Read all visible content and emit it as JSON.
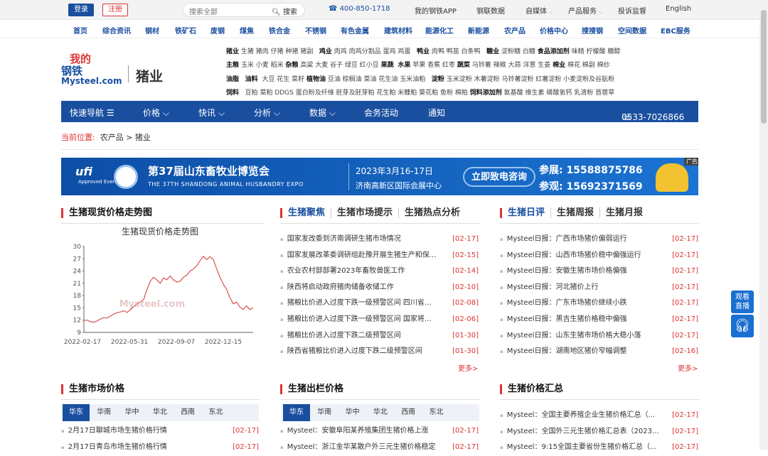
{
  "topbar": {
    "login": "登录",
    "register": "注册",
    "search_placeholder": "搜索全部",
    "search_btn": "搜索",
    "phone": "400-850-1718",
    "items": [
      "我的钢铁APP",
      "钢联数据",
      "自媒体",
      "产品服务",
      "投诉监督",
      "English"
    ]
  },
  "channels": [
    "首页",
    "综合资讯",
    "钢材",
    "铁矿石",
    "废钢",
    "煤焦",
    "铁合金",
    "不锈钢",
    "有色金属",
    "建筑材料",
    "能源化工",
    "新能源",
    "农产品",
    "价格中心",
    "搜搜钢",
    "空间数据",
    "EBC服务"
  ],
  "logo": {
    "top": "我的",
    "mid": "钢铁",
    "en": "Mysteel.com",
    "section": "猪业"
  },
  "keywords": [
    "<b>猪业</b> 生猪 猪肉 仔猪 种猪 猪副 &nbsp; <b>鸡业</b> 肉鸡 肉鸡分割品 蛋鸡 鸡蛋 &nbsp; <b>鸭业</b> 肉鸭 鸭苗 白条鸭 &nbsp; <b>糖业</b> 淀粉糖 白糖 <b>食品添加剂</b> 味精 柠檬酸 糖醇",
    "<b>主粮</b> 玉米 小麦 稻米 <b>杂粮</b> 高粱 大麦 谷子 绿豆 红小豆 <b>果蔬</b> &nbsp;<b>水果</b> 苹果 香蕉 红枣 <b>蔬菜</b> 马铃薯 辣椒 大蒜 洋葱 生姜 <b>棉业</b> 棉花 棉副 棉纱",
    "<b>油脂</b> &nbsp; <b>油料</b> &nbsp;大豆 花生 菜籽 <b>植物油</b> 豆油 棕榈油 菜油 花生油 玉米油粕 &nbsp; <b>淀粉</b> 玉米淀粉 木薯淀粉 马铃薯淀粉 红薯淀粉 小麦淀粉及谷朊粉",
    "<b>饲料</b> &nbsp; 豆粕 菜粕 DDGS 蛋白粉及纤维 胚芽及胚芽粕 花生粕 米糠粕 葵花粕 鱼粉 棉粕 <b>饲料添加剂</b> 氨基酸 维生素 磷酸氢钙 乳清粉 首蓿草"
  ],
  "nav": {
    "items": [
      "快速导航 ☰",
      "价格 ⌵",
      "快讯 ⌵",
      "分析 ⌵",
      "数据 ⌵",
      "会务活动",
      "通知"
    ],
    "phone": "0533-7026866"
  },
  "breadcrumb": {
    "label": "当前位置:",
    "path": "农产品 > 猪业"
  },
  "banner": {
    "brand": "ufi",
    "brand_sub": "Approved Event",
    "title": "第37届山东畜牧业博览会",
    "subtitle": "THE 37TH SHANDONG ANIMAL HUSBANDRY EXPO",
    "date": "2023年3月16-17日",
    "venue": "济南高新区国际会展中心",
    "cta": "立即致电咨询",
    "phone1": "参展: 15588875786",
    "phone2": "参观: 15692371569",
    "tag": "广告"
  },
  "sections": {
    "trend": {
      "title": "生猪现货价格走势图"
    },
    "focus": {
      "tabs": [
        "生猪聚焦",
        "生猪市场提示",
        "生猪热点分析"
      ],
      "items": [
        [
          "国家发改委到济南调研生猪市场情况",
          "[02-17]"
        ],
        [
          "国家发展改革委调研组赴豫开展生猪生产和保...",
          "[02-15]"
        ],
        [
          "农业农村部部署2023年畜牧兽医工作",
          "[02-14]"
        ],
        [
          "陕西将启动政府猪肉储备收储工作",
          "[02-10]"
        ],
        [
          "猪粮比价进入过度下跌一级预警区间 四川省...",
          "[02-08]"
        ],
        [
          "猪粮比价进入过度下跌一级预警区间 国家将...",
          "[02-06]"
        ],
        [
          "猪粮比价进入过度下跌二级预警区间",
          "[01-30]"
        ],
        [
          "陕西省猪粮比价进入过度下跌二级预警区间",
          "[01-30]"
        ]
      ],
      "more": "更多>"
    },
    "daily": {
      "tabs": [
        "生猪日评",
        "生猪周报",
        "生猪月报"
      ],
      "items": [
        [
          "Mysteel日报：广西市场猪价偏弱运行",
          "[02-17]"
        ],
        [
          "Mysteel日报：山西市场猪价稳中偏强运行",
          "[02-17]"
        ],
        [
          "Mysteel日报：安徽生猪市场价格偏强",
          "[02-17]"
        ],
        [
          "Mysteel日报：河北猪价上行",
          "[02-17]"
        ],
        [
          "Mysteel日报：广东市场猪价继续小跌",
          "[02-17]"
        ],
        [
          "Mysteel日报：黑吉生猪价格稳中偏强",
          "[02-17]"
        ],
        [
          "Mysteel日报：山东生猪市场价格大稳小落",
          "[02-17]"
        ],
        [
          "Mysteel日报：湖南地区猪价窄幅调整",
          "[02-16]"
        ]
      ],
      "more": "更多>"
    },
    "market": {
      "title": "生猪市场价格",
      "tabs": [
        "华东",
        "华南",
        "华中",
        "华北",
        "西南",
        "东北"
      ],
      "items": [
        [
          "2月17日聊城市场生猪价格行情",
          "[02-17]"
        ],
        [
          "2月17日青岛市场生猪价格行情",
          "[02-17]"
        ]
      ]
    },
    "slaughter": {
      "title": "生猪出栏价格",
      "tabs": [
        "华东",
        "华南",
        "华中",
        "华北",
        "西南",
        "东北"
      ],
      "items": [
        [
          "Mysteel：安徽阜阳某养殖集团生猪价格上涨",
          "[02-17]"
        ],
        [
          "Mysteel：浙江金华某散户外三元生猪价格稳定",
          "[02-17]"
        ]
      ]
    },
    "summary": {
      "title": "生猪价格汇总",
      "items": [
        [
          "Mysteel：全国主要养殖企业生猪价格汇总（...",
          "[02-17]"
        ],
        [
          "Mysteel：全国外三元生猪价格汇总表（2023...",
          "[02-17]"
        ],
        [
          "Mysteel：9:15全国主要省份生猪价格汇总（...",
          "[02-17]"
        ]
      ]
    }
  },
  "side": {
    "live": "观看直播"
  },
  "chart_data": {
    "type": "line",
    "title": "生猪现货价格走势图",
    "x_ticks": [
      "2022-02-17",
      "2022-05-31",
      "2022-09-07",
      "2022-12-15"
    ],
    "ylim": [
      9,
      30
    ],
    "y_ticks": [
      9,
      12,
      15,
      18,
      21,
      24,
      27,
      30
    ],
    "color": "#d9534f",
    "values": [
      11.9,
      12.0,
      11.6,
      11.5,
      11.8,
      12.3,
      12.6,
      12.5,
      13.0,
      13.5,
      13.8,
      14.0,
      14.3,
      13.9,
      14.5,
      15.3,
      16.0,
      16.4,
      17.0,
      19.5,
      21.5,
      22.5,
      21.8,
      21.0,
      22.3,
      21.9,
      22.8,
      21.8,
      21.3,
      21.5,
      22.5,
      23.0,
      24.0,
      24.5,
      25.3,
      26.5,
      27.6,
      26.8,
      27.5,
      26.8,
      24.5,
      22.5,
      20.8,
      19.5,
      17.5,
      16.0,
      16.4,
      15.2,
      14.6,
      15.5,
      14.6,
      15.0
    ]
  }
}
